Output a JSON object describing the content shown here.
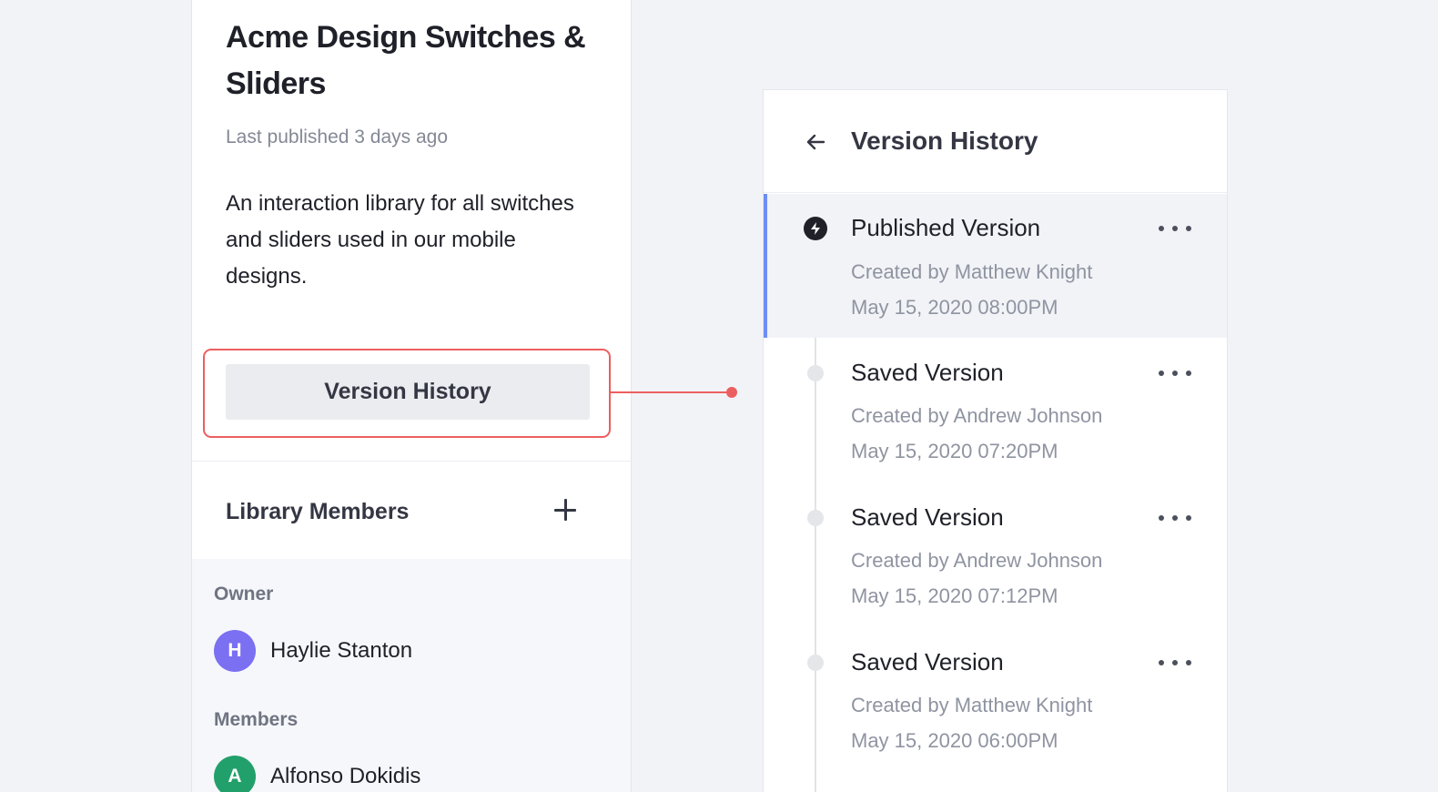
{
  "library": {
    "title": "Acme Design Switches & Sliders",
    "last_published": "Last published 3 days ago",
    "description": "An interaction library for all switches and sliders used in our mobile designs.",
    "version_history_button": "Version History",
    "members_title": "Library Members",
    "add_member_icon": "plus-icon",
    "owner_label": "Owner",
    "owner": {
      "initial": "H",
      "name": "Haylie Stanton",
      "color": "#7b6ff2"
    },
    "members_label": "Members",
    "members": [
      {
        "initial": "A",
        "name": "Alfonso Dokidis",
        "color": "#22a06b"
      }
    ]
  },
  "version_history": {
    "title": "Version History",
    "back_icon": "arrow-left-icon",
    "more_icon": "more-horizontal-icon",
    "accent_color": "#6f8df2",
    "entries": [
      {
        "title": "Published Version",
        "author": "Created by Matthew Knight",
        "date": "May 15, 2020 08:00PM",
        "published": true
      },
      {
        "title": "Saved Version",
        "author": "Created by Andrew Johnson",
        "date": "May 15, 2020 07:20PM",
        "published": false
      },
      {
        "title": "Saved Version",
        "author": "Created by Andrew Johnson",
        "date": "May 15, 2020 07:12PM",
        "published": false
      },
      {
        "title": "Saved Version",
        "author": "Created by Matthew Knight",
        "date": "May 15, 2020 06:00PM",
        "published": false
      }
    ]
  },
  "highlight_color": "#ec5f5f"
}
